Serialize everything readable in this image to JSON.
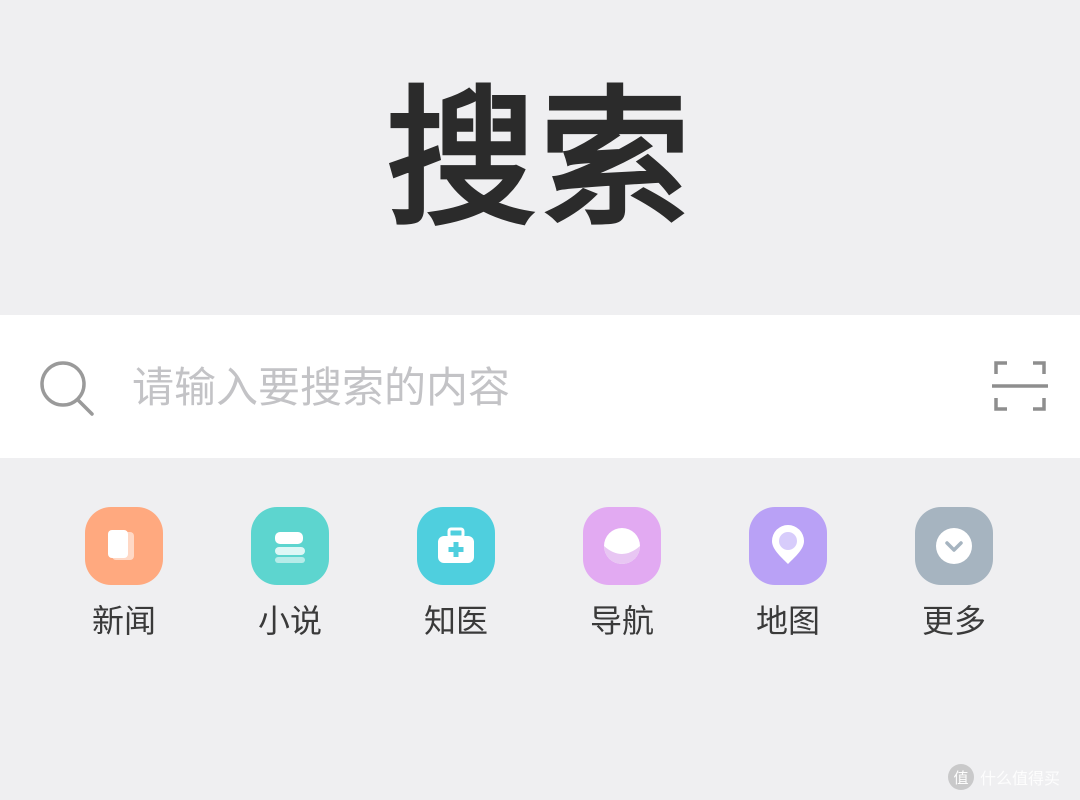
{
  "logo": {
    "text": "搜索"
  },
  "search": {
    "placeholder": "请输入要搜索的内容",
    "value": ""
  },
  "shortcuts": [
    {
      "label": "新闻",
      "icon": "news-icon",
      "color": "#ffa97f"
    },
    {
      "label": "小说",
      "icon": "novel-icon",
      "color": "#5dd5cf"
    },
    {
      "label": "知医",
      "icon": "medical-kit-icon",
      "color": "#4fcfde"
    },
    {
      "label": "导航",
      "icon": "compass-icon",
      "color": "#e2aaf2"
    },
    {
      "label": "地图",
      "icon": "map-pin-icon",
      "color": "#b9a1f6"
    },
    {
      "label": "更多",
      "icon": "chevron-down-icon",
      "color": "#a6b4c0"
    }
  ],
  "watermark": {
    "badge": "值",
    "text": "什么值得买"
  }
}
